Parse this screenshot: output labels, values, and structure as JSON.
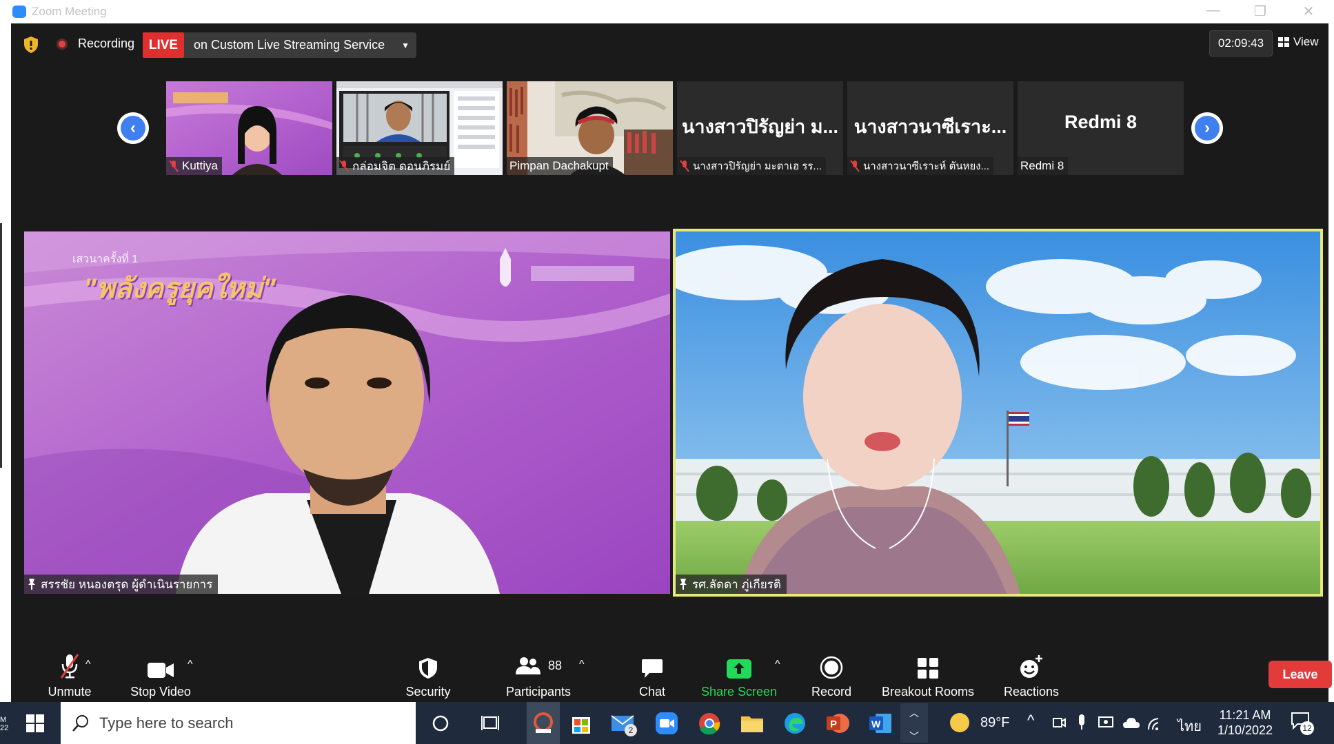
{
  "window": {
    "title": "Zoom Meeting"
  },
  "topbar": {
    "recording_label": "Recording",
    "live_label": "LIVE",
    "live_service": "on Custom Live Streaming Service",
    "timer": "02:09:43",
    "view_label": "View"
  },
  "thumbnails": [
    {
      "name": "Kuttiya",
      "muted": true
    },
    {
      "name": "กล่อมจิต  ดอนภิรมย์",
      "muted": true
    },
    {
      "name": "Pimpan Dachakupt",
      "muted": false
    },
    {
      "big_name": "นางสาวปิรัญย่า ม...",
      "name": "นางสาวปิรัญย่า มะตาเฮ รร...",
      "muted": true
    },
    {
      "big_name": "นางสาวนาซีเราะ...",
      "name": "นางสาวนาซีเราะห์ ตันหยง...",
      "muted": true
    },
    {
      "big_name": "Redmi 8",
      "name": "Redmi 8",
      "muted": false
    }
  ],
  "main_tiles": {
    "left": {
      "name": "สรรชัย หนองตรุด ผู้ดำเนินรายการ",
      "banner_title": "\"พลังครูยุคใหม่\"",
      "banner_sub": "เสวนาครั้งที่ 1"
    },
    "right": {
      "name": "รศ.ลัดดา ภู่เกียรติ"
    }
  },
  "toolbar": {
    "unmute": "Unmute",
    "stop_video": "Stop Video",
    "security": "Security",
    "participants": "Participants",
    "participants_count": "88",
    "chat": "Chat",
    "share_screen": "Share Screen",
    "record": "Record",
    "breakout_rooms": "Breakout Rooms",
    "reactions": "Reactions",
    "leave": "Leave"
  },
  "taskbar": {
    "search_placeholder": "Type here to search",
    "mail_badge": "2",
    "weather": "89°F",
    "language": "ไทย",
    "time": "11:21 AM",
    "date": "1/10/2022",
    "notification_count": "12"
  },
  "colors": {
    "zoom_blue": "#2d8cff",
    "live_red": "#e02f2f",
    "share_green": "#23d959",
    "leave_red": "#e33a3a",
    "active_speaker_border": "#e9e87a",
    "meeting_bg": "#1a1a1a",
    "taskbar_bg": "#1f2b3d"
  }
}
